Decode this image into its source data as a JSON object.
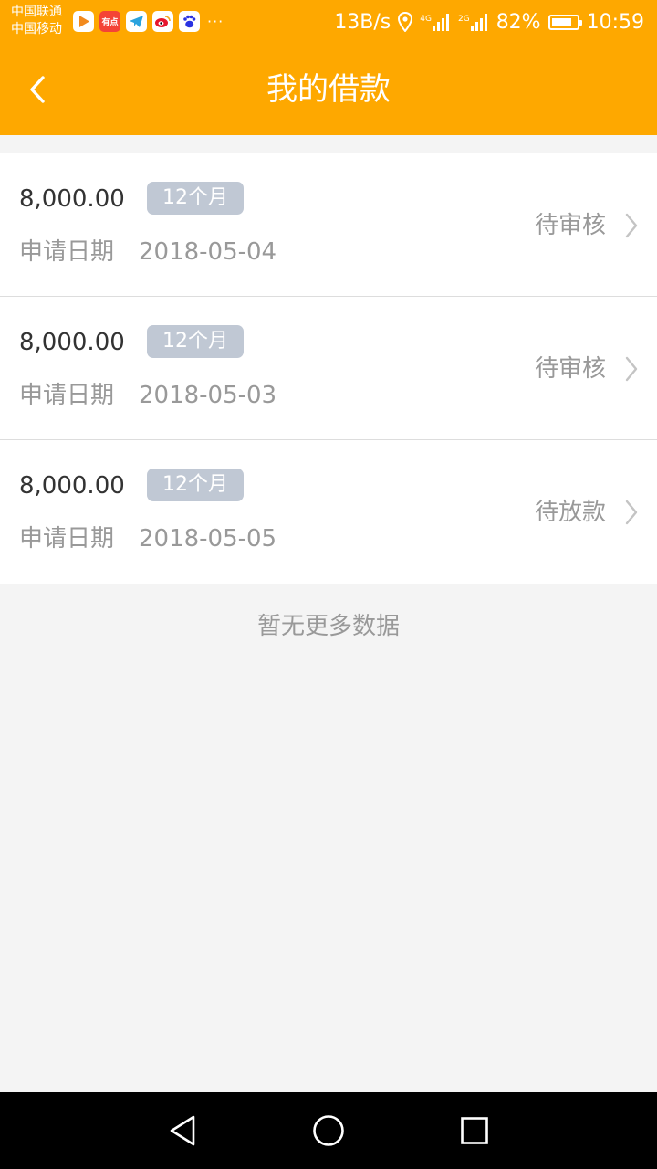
{
  "status_bar": {
    "carrier_1": "中国联通",
    "carrier_2": "中国移动",
    "app_icons": [
      {
        "icon": "video-app-icon",
        "label": "",
        "color": "#ffffff"
      },
      {
        "icon": "news-app-icon",
        "label": "有点",
        "color": "#f44336"
      },
      {
        "icon": "telegram-icon",
        "label": "",
        "color": "#ffffff"
      },
      {
        "icon": "weibo-icon",
        "label": "",
        "color": "#ffffff"
      },
      {
        "icon": "baidu-paw-icon",
        "label": "",
        "color": "#ffffff"
      }
    ],
    "more": "···",
    "net_speed": "13B/s",
    "net_4g": "4G",
    "net_2g": "2G",
    "battery": "82%",
    "battery_level": 0.82,
    "time": "10:59"
  },
  "header": {
    "title": "我的借款",
    "back_icon": "chevron-left-icon",
    "background": "#fea800"
  },
  "loans": [
    {
      "amount": "8,000.00",
      "term": "12个月",
      "date_label": "申请日期",
      "date": "2018-05-04",
      "status": "待审核"
    },
    {
      "amount": "8,000.00",
      "term": "12个月",
      "date_label": "申请日期",
      "date": "2018-05-03",
      "status": "待审核"
    },
    {
      "amount": "8,000.00",
      "term": "12个月",
      "date_label": "申请日期",
      "date": "2018-05-05",
      "status": "待放款"
    }
  ],
  "footer_text": "暂无更多数据",
  "nav_bar": {
    "back": "triangle-back-icon",
    "home": "circle-home-icon",
    "recents": "square-recents-icon"
  }
}
